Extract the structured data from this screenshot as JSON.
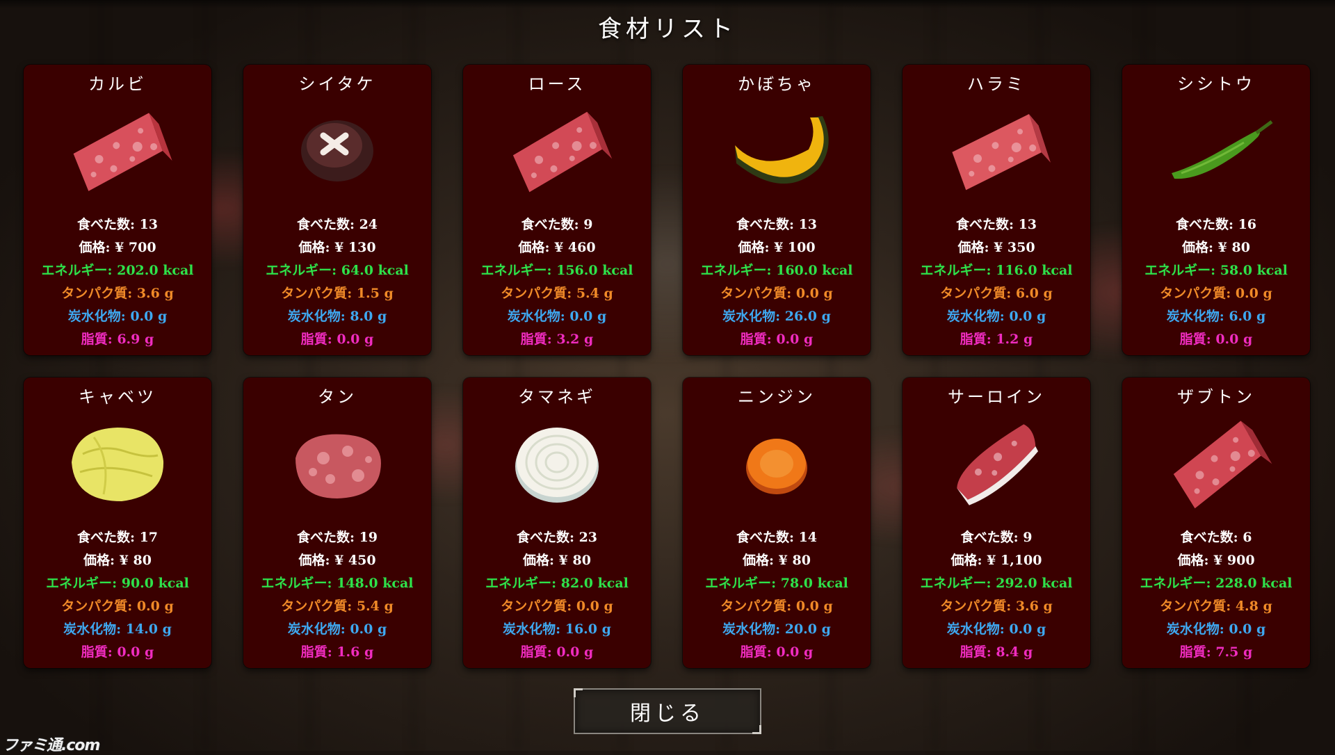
{
  "title": "食材リスト",
  "close_label": "閉じる",
  "watermark": "ファミ通.com",
  "colors": {
    "card_bg": "#3a0000",
    "energy": "#2ee24a",
    "protein": "#f08a28",
    "carb": "#3ea8f0",
    "fat": "#f02cc0"
  },
  "items": [
    {
      "name": "カルビ",
      "icon": "karubi-meat",
      "eaten": "食べた数: 13",
      "price": "価格: ¥ 700",
      "energy": "エネルギー: 202.0 kcal",
      "protein": "タンパク質: 3.6 g",
      "carb": "炭水化物: 0.0 g",
      "fat": "脂質: 6.9 g"
    },
    {
      "name": "シイタケ",
      "icon": "shiitake-mushroom",
      "eaten": "食べた数: 24",
      "price": "価格: ¥ 130",
      "energy": "エネルギー: 64.0 kcal",
      "protein": "タンパク質: 1.5 g",
      "carb": "炭水化物: 8.0 g",
      "fat": "脂質: 0.0 g"
    },
    {
      "name": "ロース",
      "icon": "rosu-meat",
      "eaten": "食べた数: 9",
      "price": "価格: ¥ 460",
      "energy": "エネルギー: 156.0 kcal",
      "protein": "タンパク質: 5.4 g",
      "carb": "炭水化物: 0.0 g",
      "fat": "脂質: 3.2 g"
    },
    {
      "name": "かぼちゃ",
      "icon": "pumpkin-slice",
      "eaten": "食べた数: 13",
      "price": "価格: ¥ 100",
      "energy": "エネルギー: 160.0 kcal",
      "protein": "タンパク質: 0.0 g",
      "carb": "炭水化物: 26.0 g",
      "fat": "脂質: 0.0 g"
    },
    {
      "name": "ハラミ",
      "icon": "harami-meat",
      "eaten": "食べた数: 13",
      "price": "価格: ¥ 350",
      "energy": "エネルギー: 116.0 kcal",
      "protein": "タンパク質: 6.0 g",
      "carb": "炭水化物: 0.0 g",
      "fat": "脂質: 1.2 g"
    },
    {
      "name": "シシトウ",
      "icon": "shishito-pepper",
      "eaten": "食べた数: 16",
      "price": "価格: ¥ 80",
      "energy": "エネルギー: 58.0 kcal",
      "protein": "タンパク質: 0.0 g",
      "carb": "炭水化物: 6.0 g",
      "fat": "脂質: 0.0 g"
    },
    {
      "name": "キャベツ",
      "icon": "cabbage",
      "eaten": "食べた数: 17",
      "price": "価格: ¥ 80",
      "energy": "エネルギー: 90.0 kcal",
      "protein": "タンパク質: 0.0 g",
      "carb": "炭水化物: 14.0 g",
      "fat": "脂質: 0.0 g"
    },
    {
      "name": "タン",
      "icon": "tongue-meat",
      "eaten": "食べた数: 19",
      "price": "価格: ¥ 450",
      "energy": "エネルギー: 148.0 kcal",
      "protein": "タンパク質: 5.4 g",
      "carb": "炭水化物: 0.0 g",
      "fat": "脂質: 1.6 g"
    },
    {
      "name": "タマネギ",
      "icon": "onion-slice",
      "eaten": "食べた数: 23",
      "price": "価格: ¥ 80",
      "energy": "エネルギー: 82.0 kcal",
      "protein": "タンパク質: 0.0 g",
      "carb": "炭水化物: 16.0 g",
      "fat": "脂質: 0.0 g"
    },
    {
      "name": "ニンジン",
      "icon": "carrot-slice",
      "eaten": "食べた数: 14",
      "price": "価格: ¥ 80",
      "energy": "エネルギー: 78.0 kcal",
      "protein": "タンパク質: 0.0 g",
      "carb": "炭水化物: 20.0 g",
      "fat": "脂質: 0.0 g"
    },
    {
      "name": "サーロイン",
      "icon": "sirloin-meat",
      "eaten": "食べた数: 9",
      "price": "価格: ¥ 1,100",
      "energy": "エネルギー: 292.0 kcal",
      "protein": "タンパク質: 3.6 g",
      "carb": "炭水化物: 0.0 g",
      "fat": "脂質: 8.4 g"
    },
    {
      "name": "ザブトン",
      "icon": "zabuton-meat",
      "eaten": "食べた数: 6",
      "price": "価格: ¥ 900",
      "energy": "エネルギー: 228.0 kcal",
      "protein": "タンパク質: 4.8 g",
      "carb": "炭水化物: 0.0 g",
      "fat": "脂質: 7.5 g"
    }
  ]
}
